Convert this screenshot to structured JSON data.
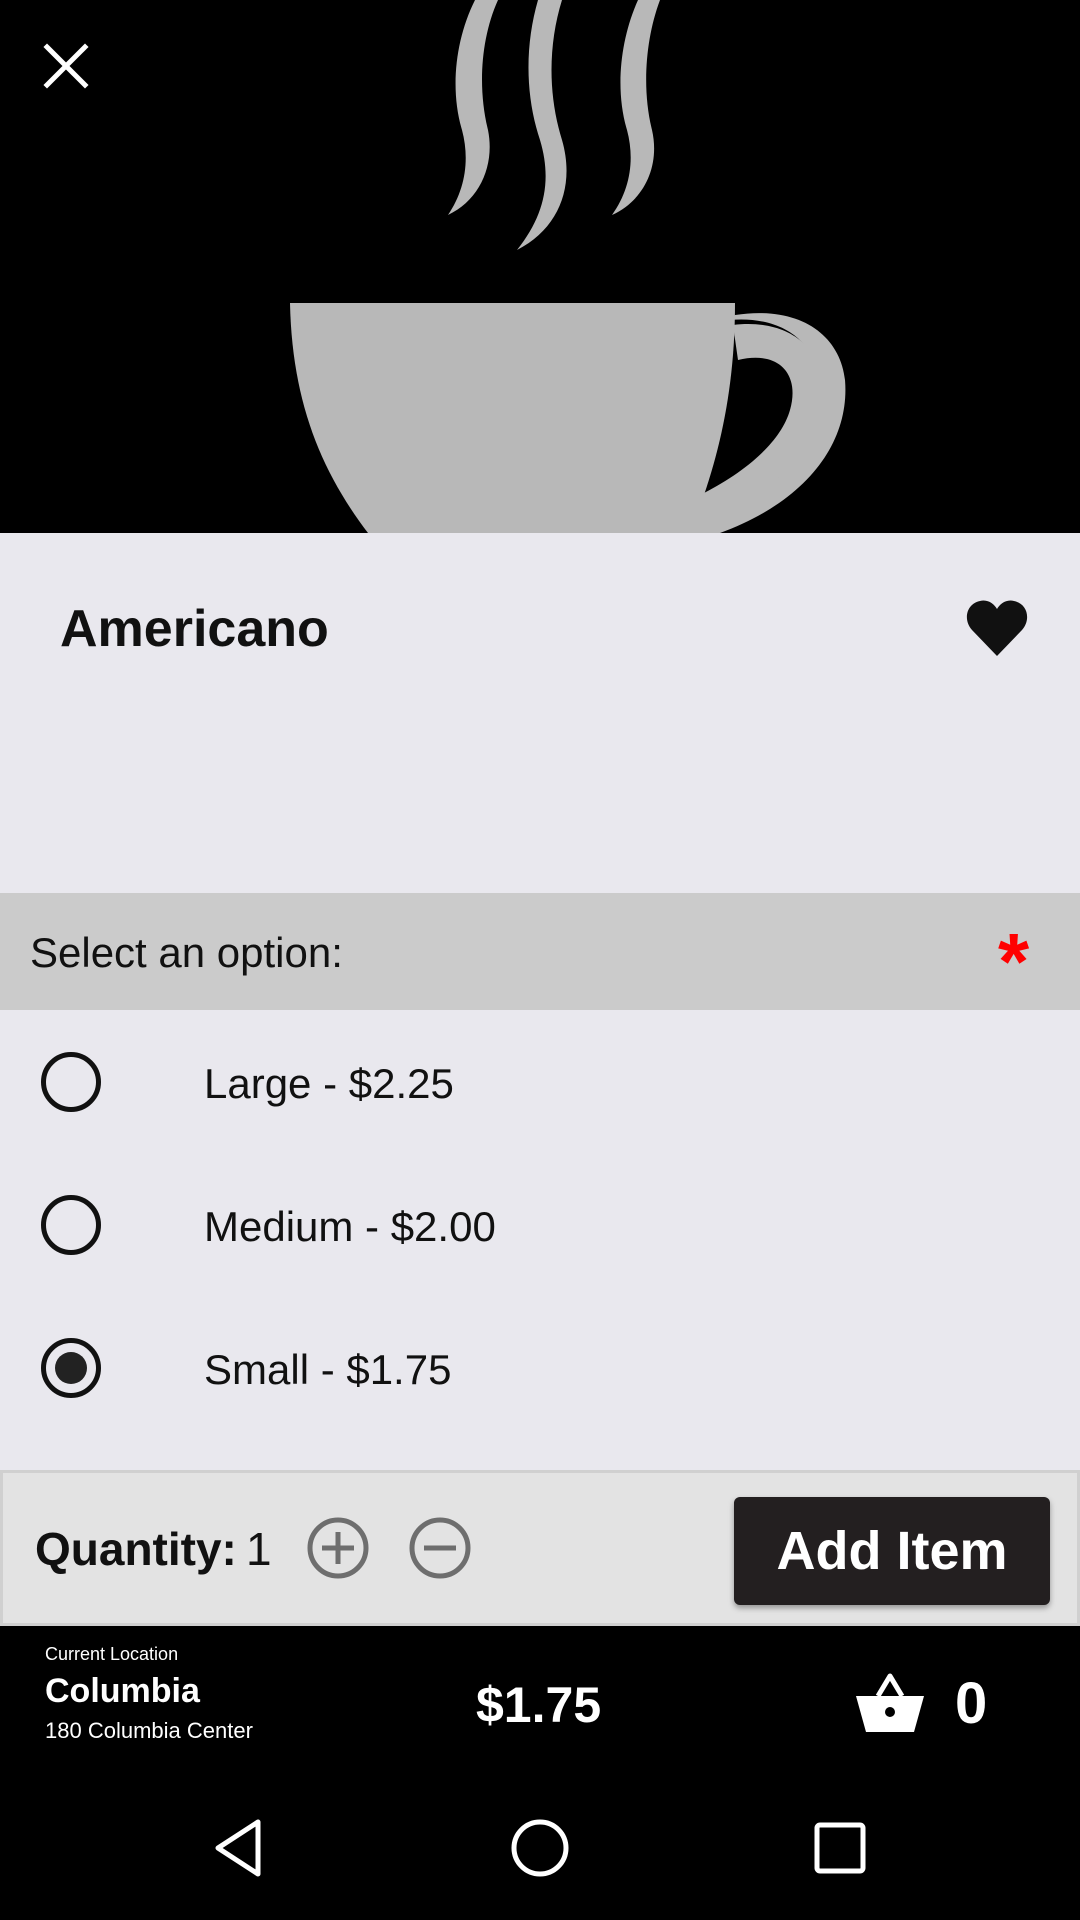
{
  "product": {
    "title": "Americano"
  },
  "options": {
    "header_label": "Select an option:",
    "required_mark": "*",
    "items": [
      {
        "label": "Large - $2.25",
        "selected": false
      },
      {
        "label": "Medium - $2.00",
        "selected": false
      },
      {
        "label": "Small - $1.75",
        "selected": true
      }
    ]
  },
  "quantity": {
    "label": "Quantity:",
    "value": "1",
    "add_button_label": "Add Item"
  },
  "footer": {
    "location_caption": "Current Location",
    "location_name": "Columbia",
    "location_address": "180 Columbia Center",
    "total": "$1.75",
    "basket_count": "0"
  },
  "icons": {
    "close": "close-icon",
    "favorite": "heart-icon",
    "increment": "plus-circle-icon",
    "decrement": "minus-circle-icon",
    "basket": "basket-icon",
    "nav_back": "back-triangle-icon",
    "nav_home": "home-circle-icon",
    "nav_recents": "recents-square-icon"
  },
  "colors": {
    "hero_bg": "#000000",
    "hero_art": "#b8b8b8",
    "page_bg": "#e9e8ee",
    "option_header_bg": "#cbcbcb",
    "required": "#ff0000",
    "button_bg": "#231f20",
    "footer_bg": "#000000"
  }
}
